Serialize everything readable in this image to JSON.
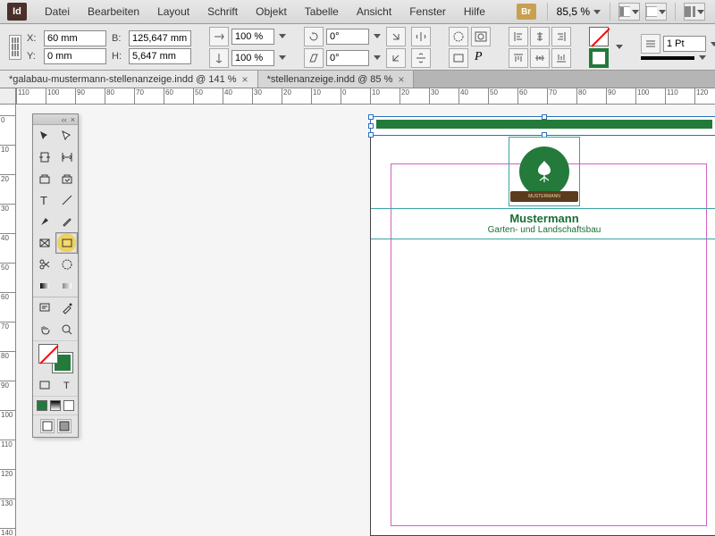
{
  "app": {
    "logo": "Id"
  },
  "menu": [
    "Datei",
    "Bearbeiten",
    "Layout",
    "Schrift",
    "Objekt",
    "Tabelle",
    "Ansicht",
    "Fenster",
    "Hilfe"
  ],
  "top_right": {
    "bridge": "Br",
    "zoom": "85,5 %"
  },
  "control": {
    "x": "60 mm",
    "y": "0 mm",
    "w": "125,647 mm",
    "h": "5,647 mm",
    "scale_x": "100 %",
    "scale_y": "100 %",
    "rotate": "0°",
    "shear": "0°",
    "stroke_weight": "1 Pt"
  },
  "tabs": [
    {
      "label": "*galabau-mustermann-stellenanzeige.indd @ 141 %",
      "active": true
    },
    {
      "label": "*stellenanzeige.indd @ 85 %",
      "active": false
    }
  ],
  "ruler_h": [
    110,
    100,
    90,
    80,
    70,
    60,
    50,
    40,
    30,
    20,
    10,
    0,
    10,
    20,
    30,
    40,
    50,
    60,
    70,
    80,
    90,
    100,
    110,
    120
  ],
  "ruler_v": [
    0,
    10,
    20,
    30,
    40,
    50,
    60,
    70,
    80,
    90,
    100,
    110,
    120,
    130,
    140
  ],
  "document": {
    "company_name": "Mustermann",
    "company_sub": "Garten- und Landschaftsbau",
    "logo_text": "MUSTERMANN"
  },
  "labels": {
    "x": "X:",
    "y": "Y:",
    "w": "B:",
    "h": "H:",
    "chev": "‹‹"
  }
}
